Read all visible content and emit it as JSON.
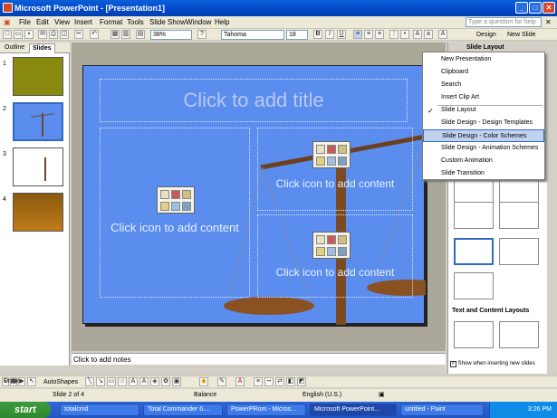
{
  "window": {
    "title": "Microsoft PowerPoint - [Presentation1]"
  },
  "menu": [
    "File",
    "Edit",
    "View",
    "Insert",
    "Format",
    "Tools",
    "Slide Show",
    "Window",
    "Help"
  ],
  "help_placeholder": "Type a question for help",
  "toolbar": {
    "zoom": "38%",
    "font": "Tahoma",
    "size": "18",
    "bold": "B",
    "italic": "I",
    "underline": "U",
    "design": "Design",
    "new_slide": "New Slide"
  },
  "pane_tabs": {
    "outline": "Outline",
    "slides": "Slides"
  },
  "slides": [
    "1",
    "2",
    "3",
    "4"
  ],
  "slide": {
    "title": "Click to add title",
    "left_content": "Click icon to add content",
    "top_right_content": "Click icon to add content",
    "bottom_right_content": "Click icon to add content"
  },
  "notes": "Click to add notes",
  "taskpane": {
    "title": "Slide Layout",
    "menu": [
      "New Presentation",
      "Clipboard",
      "Search",
      "Insert Clip Art",
      "Slide Layout",
      "Slide Design - Design Templates",
      "Slide Design - Color Schemes",
      "Slide Design - Animation Schemes",
      "Custom Animation",
      "Slide Transition"
    ],
    "selected": "Slide Design - Color Schemes",
    "checked": "Slide Layout",
    "section": "Text and Content Layouts",
    "show_when": "Show when inserting new slides"
  },
  "drawbar": {
    "draw": "Draw",
    "autoshapes": "AutoShapes"
  },
  "status": {
    "slide": "Slide 2 of 4",
    "design": "Balance",
    "language": "English (U.S.)"
  },
  "taskbar": {
    "start": "start",
    "items": [
      "totalcmd",
      "Total Commander 6....",
      "PowerPRom - Micros...",
      "Microsoft PowerPoint...",
      "untitled - Paint"
    ],
    "clock": "3:26 PM"
  }
}
